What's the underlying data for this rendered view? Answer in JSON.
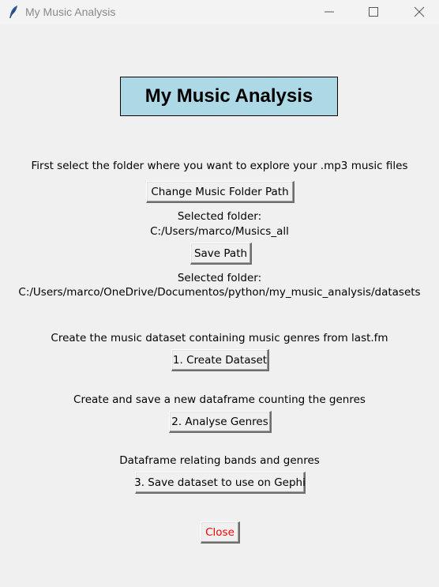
{
  "window": {
    "title": "My Music Analysis",
    "icon": "feather-icon",
    "controls": [
      "minimize-icon",
      "maximize-icon",
      "close-icon"
    ]
  },
  "heading": {
    "text": "My Music Analysis",
    "background": "#add8e6"
  },
  "folder_section": {
    "instruction": "First select the folder where you want to explore your .mp3 music files",
    "change_button": "Change Music Folder Path",
    "selected_label": "Selected folder:",
    "selected_path": "C:/Users/marco/Musics_all",
    "save_button": "Save Path",
    "saved_label": "Selected folder:",
    "saved_path": "C:/Users/marco/OneDrive/Documentos/python/my_music_analysis/datasets"
  },
  "dataset_section": {
    "instruction": "Create the music dataset containing music genres from last.fm",
    "button": "1. Create Dataset"
  },
  "genres_section": {
    "instruction": "Create and save a new dataframe counting the genres",
    "button": "2. Analyse Genres"
  },
  "gephi_section": {
    "instruction": "Dataframe relating bands and genres",
    "button": "3. Save dataset to use on Gephi"
  },
  "close_button": {
    "label": "Close",
    "color": "#ff0000"
  }
}
